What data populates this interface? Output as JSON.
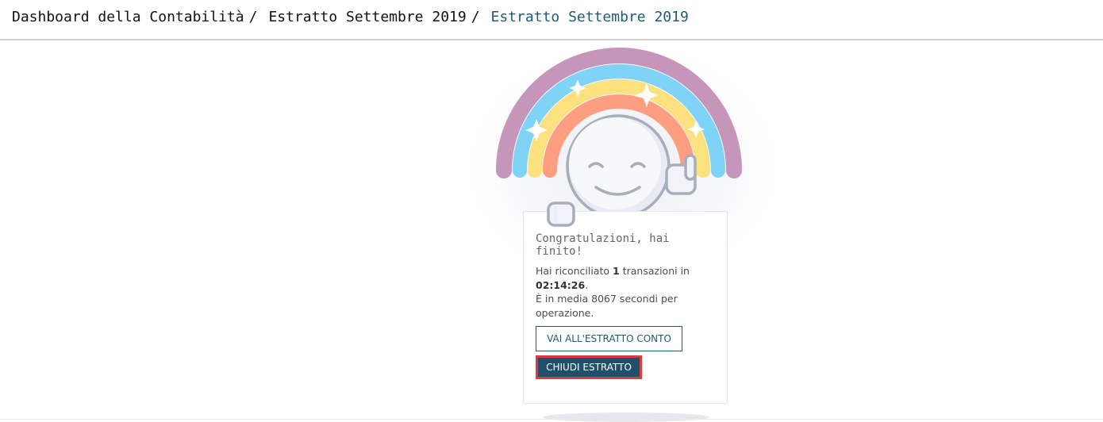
{
  "breadcrumb": {
    "items": [
      {
        "label": "Dashboard della Contabilità"
      },
      {
        "label": "Estratto Settembre 2019"
      }
    ],
    "separator": "/",
    "current": "Estratto Settembre 2019"
  },
  "card": {
    "title": "Congratulazioni, hai finito!",
    "text": {
      "prefix": "Hai riconciliato ",
      "count": "1",
      "middle": " transazioni in ",
      "time": "02:14:26",
      "after_time": ".",
      "average": "È in media 8067 secondi per operazione."
    },
    "buttons": {
      "go_to_statement": "VAI ALL'ESTRATTO CONTO",
      "close_statement": "CHIUDI ESTRATTO"
    }
  },
  "colors": {
    "accent": "#1f5b75",
    "primary_button": "#1f4f6b",
    "highlight_border": "#e03a3a",
    "rainbow": [
      "#c595ba",
      "#7fd3f7",
      "#fde17e",
      "#fe9d80"
    ]
  },
  "icons": {
    "illustration": "rainbow-smiley-icon",
    "sparkles": "sparkle-icon",
    "thumbs_up": "thumbs-up-icon",
    "hand": "pointing-hand-icon"
  }
}
